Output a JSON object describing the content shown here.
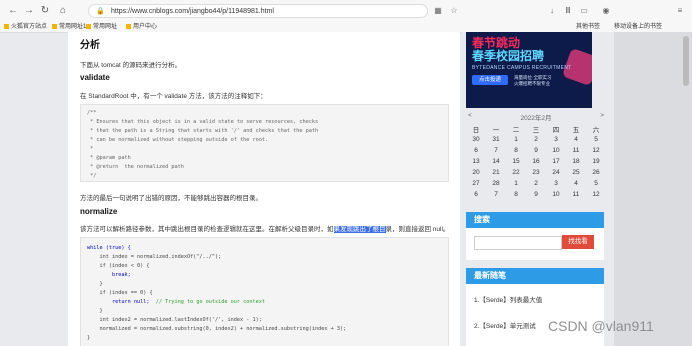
{
  "browser": {
    "url": "https://www.cnblogs.com/jiangbo44/p/11948981.html",
    "bookmarks": [
      "火狐官方站点",
      "常用网址1",
      "常用网址",
      "用户中心"
    ],
    "right_bookmarks": [
      "其他书签",
      "移动设备上的书签"
    ]
  },
  "article": {
    "heading": "分析",
    "intro": "下面从 tomcat 的源码来进行分析。",
    "validate_heading": "validate",
    "validate_text": "在 StandardRoot 中，有一个 validate 方法，该方法的注释如下：",
    "code1": [
      "/**",
      " * Ensures that this object is in a valid state to serve resources, checks",
      " * that the path is a String that starts with '/' and checks that the path",
      " * can be normalized without stepping outside of the root.",
      " *",
      " * @param path",
      " * @return  the normalized path",
      " */"
    ],
    "after_code_text": "方法的最后一句说明了出错的原因，不能够跳出容器的根目录。",
    "normalize_heading": "normalize",
    "normalize_text_pre": "该方法可以解析路径参数，其中跳出根目录的检查逻辑就在这里。在解析父级目录时，如",
    "normalize_text_hl": "果发现跳出了根目",
    "normalize_text_post": "录，则直接返回 null。",
    "code2": {
      "l1": "while (true) {",
      "l2a": "    int index = normalized.indexOf(\"/../\");",
      "l3": "    if (index < 0) {",
      "l4": "        break;",
      "l5": "    }",
      "l6": "    if (index == 0) {",
      "l7a": "        return null;",
      "l7b": "  // Trying to go outside our context",
      "l8": "    }",
      "l9": "    int index2 = normalized.lastIndexOf('/', index - 1);",
      "l10": "    normalized = normalized.substring(0, index2) + normalized.substring(index + 3);",
      "l11": "}"
    }
  },
  "sidebar": {
    "banner": {
      "line1": "春节跳动",
      "line2": "春季校园招聘",
      "line3": "BYTEDANCE CAMPUS RECRUITMENT",
      "button": "点击投递",
      "side1": "海量岗位·全职实习",
      "side2": "火爆招聘不限专业"
    },
    "calendar": {
      "prev": "<",
      "title": "2022年2月",
      "next": ">",
      "weekdays": [
        "日",
        "一",
        "二",
        "三",
        "四",
        "五",
        "六"
      ],
      "rows": [
        [
          "30",
          "31",
          "1",
          "2",
          "3",
          "4",
          "5"
        ],
        [
          "6",
          "7",
          "8",
          "9",
          "10",
          "11",
          "12"
        ],
        [
          "13",
          "14",
          "15",
          "16",
          "17",
          "18",
          "19"
        ],
        [
          "20",
          "21",
          "22",
          "23",
          "24",
          "25",
          "26"
        ],
        [
          "27",
          "28",
          "1",
          "2",
          "3",
          "4",
          "5"
        ],
        [
          "6",
          "7",
          "8",
          "9",
          "10",
          "11",
          "12"
        ]
      ]
    },
    "search": {
      "title": "搜索",
      "button": "找找看"
    },
    "recent": {
      "title": "最新随笔",
      "items": [
        "1.【Serde】列表最大值",
        "2.【Serde】单元测试"
      ]
    }
  },
  "watermark": "CSDN @vlan911"
}
